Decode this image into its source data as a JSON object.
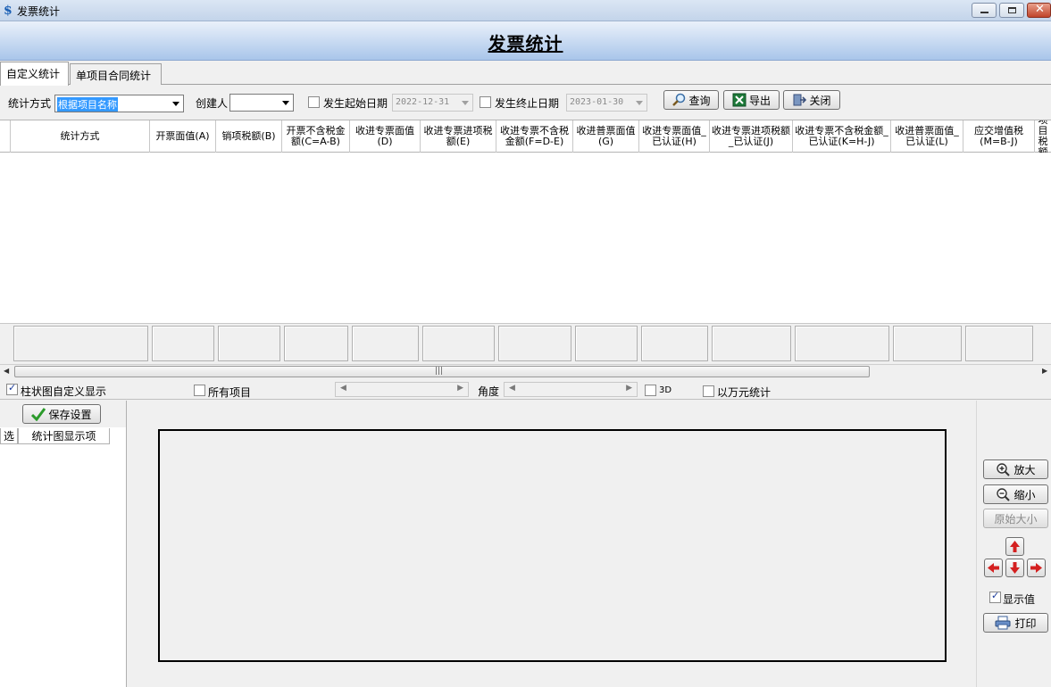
{
  "window": {
    "title": "发票统计"
  },
  "banner": {
    "title": "发票统计"
  },
  "tabs": [
    {
      "label": "自定义统计"
    },
    {
      "label": "单项目合同统计"
    }
  ],
  "filter": {
    "stat_method_label": "统计方式",
    "stat_method_value": "根据项目名称",
    "creator_label": "创建人",
    "creator_value": "",
    "start_date_label": "发生起始日期",
    "start_date_value": "2022-12-31",
    "end_date_label": "发生终止日期",
    "end_date_value": "2023-01-30",
    "query_label": "查询",
    "export_label": "导出",
    "close_label": "关闭"
  },
  "table": {
    "columns": [
      "统计方式",
      "开票面值(A)",
      "销项税额(B)",
      "开票不含税金额(C=A-B)",
      "收进专票面值(D)",
      "收进专票进项税额(E)",
      "收进专票不含税金额(F=D-E)",
      "收进普票面值(G)",
      "收进专票面值_已认证(H)",
      "收进专票进项税额_已认证(J)",
      "收进专票不含税金额_已认证(K=H-J)",
      "收进普票面值_已认证(L)",
      "应交增值税(M=B-J)",
      "项目税额"
    ]
  },
  "options": {
    "bar_custom_label": "柱状图自定义显示",
    "bar_custom_checked": true,
    "all_items_label": "所有项目",
    "angle_label": "角度",
    "three_d_label": "3D",
    "ten_thousand_label": "以万元统计"
  },
  "left_panel": {
    "save_label": "保存设置",
    "col_select": "选",
    "col_item": "统计图显示项"
  },
  "right_panel": {
    "zoom_in_label": "放大",
    "zoom_out_label": "缩小",
    "original_size_label": "原始大小",
    "show_value_label": "显示值",
    "show_value_checked": true,
    "print_label": "打印"
  }
}
